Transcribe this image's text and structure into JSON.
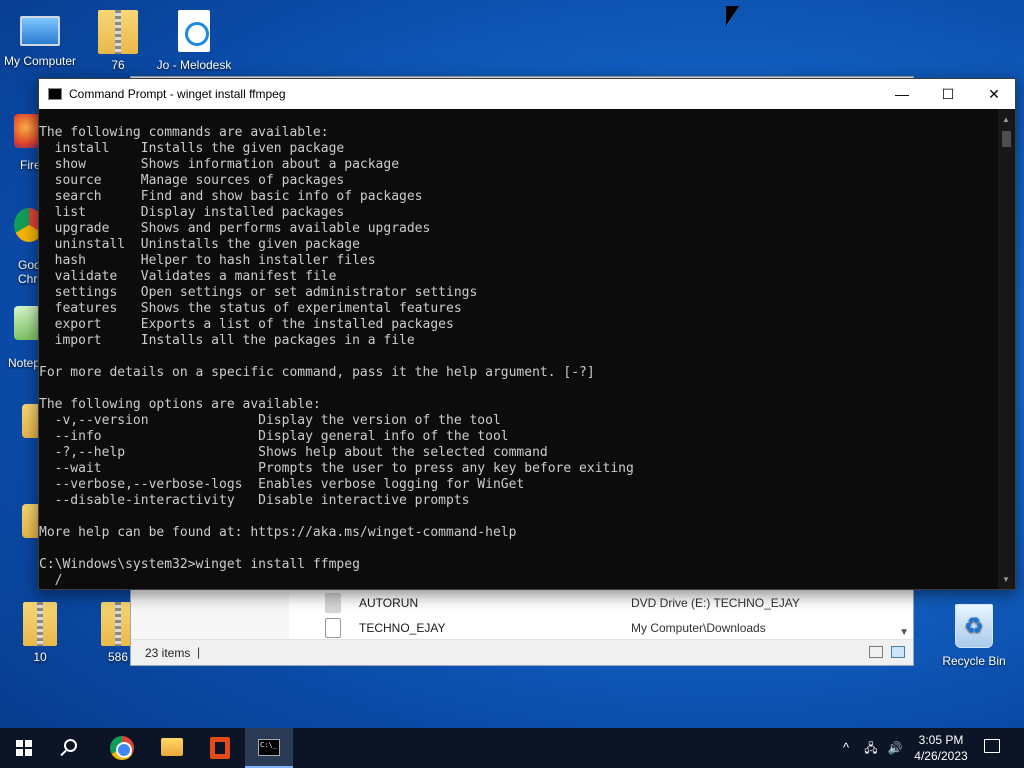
{
  "desktop": {
    "icons": [
      {
        "label": "My Computer"
      },
      {
        "label": "76"
      },
      {
        "label": "Jo - Melodesk"
      },
      {
        "label": "Fire"
      },
      {
        "label": "Goo\nChro"
      },
      {
        "label": "Notep"
      },
      {
        "label": "10"
      },
      {
        "label": "586"
      },
      {
        "label": "Recycle Bin"
      }
    ]
  },
  "explorer": {
    "rows": [
      {
        "name": "AUTORUN",
        "location": "DVD Drive (E:) TECHNO_EJAY"
      },
      {
        "name": "TECHNO_EJAY",
        "location": "My Computer\\Downloads"
      }
    ],
    "status": "23 items"
  },
  "cmd": {
    "title": "Command Prompt - winget  install ffmpeg",
    "output": "The following commands are available:\n  install    Installs the given package\n  show       Shows information about a package\n  source     Manage sources of packages\n  search     Find and show basic info of packages\n  list       Display installed packages\n  upgrade    Shows and performs available upgrades\n  uninstall  Uninstalls the given package\n  hash       Helper to hash installer files\n  validate   Validates a manifest file\n  settings   Open settings or set administrator settings\n  features   Shows the status of experimental features\n  export     Exports a list of the installed packages\n  import     Installs all the packages in a file\n\nFor more details on a specific command, pass it the help argument. [-?]\n\nThe following options are available:\n  -v,--version              Display the version of the tool\n  --info                    Display general info of the tool\n  -?,--help                 Shows help about the selected command\n  --wait                    Prompts the user to press any key before exiting\n  --verbose,--verbose-logs  Enables verbose logging for WinGet\n  --disable-interactivity   Disable interactive prompts\n\nMore help can be found at: https://aka.ms/winget-command-help\n\nC:\\Windows\\system32>winget install ffmpeg\n  /",
    "buttons": {
      "minimize": "—",
      "maximize": "☐",
      "close": "✕"
    }
  },
  "taskbar": {
    "time": "3:05 PM",
    "date": "4/26/2023",
    "tray_chevron": "^",
    "tray_network": "🖧",
    "tray_volume": "🔊"
  },
  "colors": {
    "desktop_accent": "#1466c9",
    "cmd_background": "#0c0c0c",
    "cmd_text": "#cccccc",
    "taskbar": "#0b1526"
  }
}
